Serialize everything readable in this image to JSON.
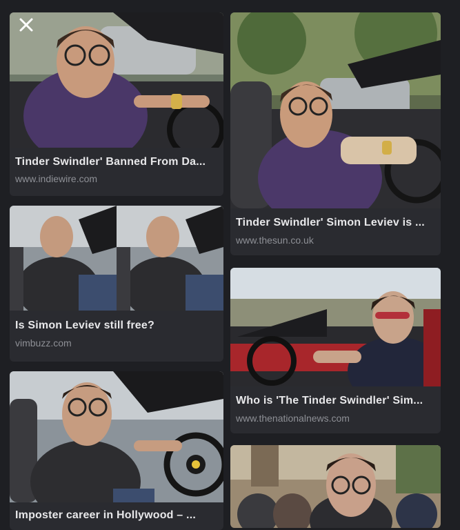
{
  "close_icon": "close-icon",
  "results": [
    {
      "title": "Tinder Swindler' Banned From Da...",
      "source": "www.indiewire.com"
    },
    {
      "title": "Tinder Swindler' Simon Leviev is ...",
      "source": "www.thesun.co.uk"
    },
    {
      "title": "Is Simon Leviev still free?",
      "source": "vimbuzz.com"
    },
    {
      "title": "Who is 'The Tinder Swindler' Sim...",
      "source": "www.thenationalnews.com"
    },
    {
      "title": "Imposter career in Hollywood – ...",
      "source": ""
    },
    {
      "title": "",
      "source": ""
    }
  ],
  "colors": {
    "background": "#1e1f23",
    "card": "#2a2b30",
    "title": "#e8e8ea",
    "source": "#8e9096"
  }
}
